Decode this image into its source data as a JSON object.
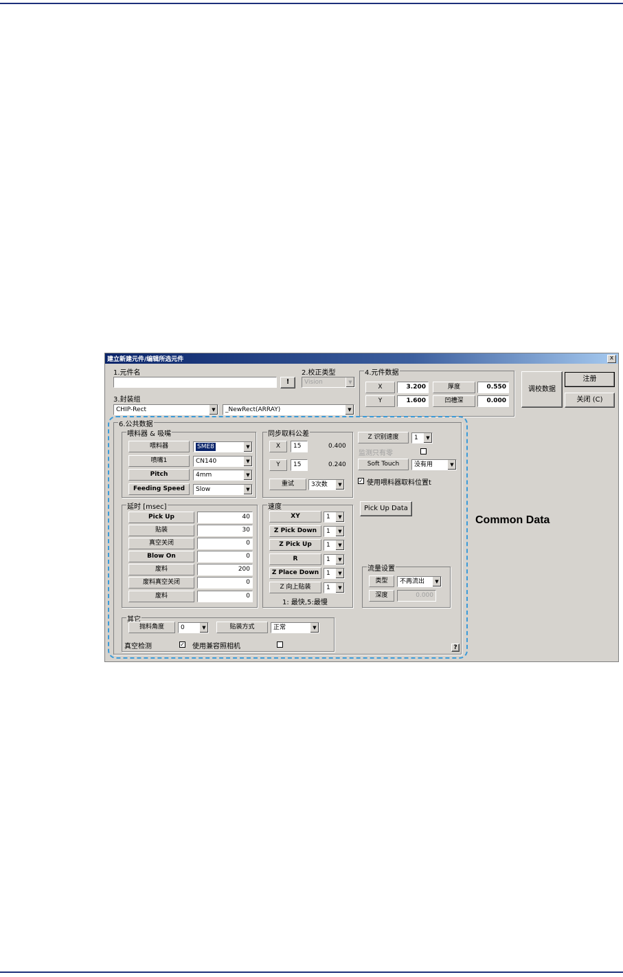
{
  "window": {
    "title": "建立新建元件/编辑所选元件",
    "close_glyph": "x",
    "help_glyph": "?"
  },
  "part_name": {
    "label": "1.元件名",
    "value": "",
    "lookup_button": "!"
  },
  "calibration_type": {
    "label": "2.校正类型",
    "value": "Vision"
  },
  "package_group": {
    "label": "3.封装组",
    "value1": "CHIP-Rect",
    "value2": "_NewRect(ARRAY)"
  },
  "part_data": {
    "label": "4.元件数据",
    "x_label": "X",
    "x_value": "3.200",
    "y_label": "Y",
    "y_value": "1.600",
    "thickness_label": "厚度",
    "thickness_value": "0.550",
    "groove_label": "凹槽深",
    "groove_value": "0.000"
  },
  "buttons": {
    "calibrate": "调校数据",
    "register": "注册",
    "close": "关闭 (C)",
    "pickup_data": "Pick Up Data"
  },
  "common_data": {
    "label": "6.公共数据"
  },
  "feeder": {
    "label": "喂料器 & 吸嘴",
    "rows": [
      {
        "label": "喂料器",
        "value": "SME8"
      },
      {
        "label": "喷嘴1",
        "value": "CN140"
      },
      {
        "label": "Pitch",
        "value": "4mm"
      },
      {
        "label": "Feeding Speed",
        "value": "Slow"
      }
    ]
  },
  "sync_tolerance": {
    "label": "同步取料公差",
    "x_label": "X",
    "x_value": "15",
    "x_result": "0.400",
    "y_label": "Y",
    "y_value": "15",
    "y_result": "0.240",
    "retry_label": "重试",
    "retry_value": "3次数"
  },
  "z_options": {
    "z_speed_label": "Z 识别速度",
    "z_speed_value": "1",
    "monitor_label": "监测只有零",
    "soft_touch_label": "Soft Touch",
    "soft_touch_value": "没有用",
    "use_feeder_pos_label": "使用喂料器取料位置t"
  },
  "delay": {
    "label": "延时 [msec]",
    "rows": [
      {
        "label": "Pick Up",
        "value": "40"
      },
      {
        "label": "贴装",
        "value": "30"
      },
      {
        "label": "真空关闭",
        "value": "0"
      },
      {
        "label": "Blow On",
        "value": "0"
      },
      {
        "label": "废料",
        "value": "200"
      },
      {
        "label": "废料真空关闭",
        "value": "0"
      },
      {
        "label": "废料",
        "value": "0"
      }
    ]
  },
  "speed": {
    "label": "速度",
    "rows": [
      {
        "label": "XY",
        "value": "1"
      },
      {
        "label": "Z Pick Down",
        "value": "1"
      },
      {
        "label": "Z Pick Up",
        "value": "1"
      },
      {
        "label": "R",
        "value": "1"
      },
      {
        "label": "Z Place Down",
        "value": "1"
      },
      {
        "label": "Z 向上贴装",
        "value": "1"
      }
    ],
    "note": "1: 最快,5:最慢"
  },
  "flow": {
    "label": "流量设置",
    "type_label": "类型",
    "type_value": "不再流出",
    "depth_label": "深度",
    "depth_value": "0.000"
  },
  "other": {
    "label": "其它",
    "angle_label": "抛料角度",
    "angle_value": "0",
    "mount_label": "贴装方式",
    "mount_value": "正常",
    "vacuum_label": "真空检测",
    "compat_label": "使用兼容照相机"
  },
  "callout": "Common Data"
}
